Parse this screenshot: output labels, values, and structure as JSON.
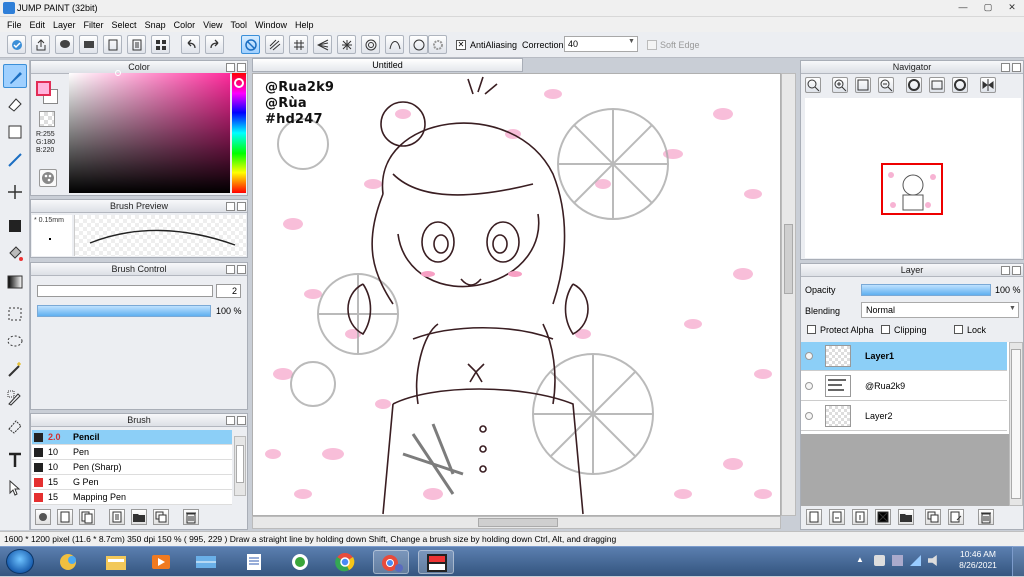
{
  "window": {
    "title": "JUMP PAINT (32bit)",
    "min": "—",
    "max": "▢",
    "close": "✕"
  },
  "menu": [
    "File",
    "Edit",
    "Layer",
    "Filter",
    "Select",
    "Snap",
    "Color",
    "View",
    "Tool",
    "Window",
    "Help"
  ],
  "toolbar": {
    "antialiasing_label": "AntiAliasing",
    "antialiasing_mark": "✕",
    "correction_label": "Correction",
    "correction_value": "40",
    "soft_edge_label": "Soft Edge"
  },
  "color_panel": {
    "title": "Color",
    "r": "R:255",
    "g": "G:180",
    "b": "B:220",
    "fg": "#ffb4dc"
  },
  "brush_preview": {
    "title": "Brush Preview",
    "size_label": "* 0.15mm"
  },
  "brush_control": {
    "title": "Brush Control",
    "size": "2",
    "opacity": "100 %"
  },
  "brush_panel": {
    "title": "Brush",
    "items": [
      {
        "size": "2.0",
        "name": "Pencil",
        "color": "#222222"
      },
      {
        "size": "10",
        "name": "Pen",
        "color": "#222222"
      },
      {
        "size": "10",
        "name": "Pen (Sharp)",
        "color": "#222222"
      },
      {
        "size": "15",
        "name": "G Pen",
        "color": "#e53030"
      },
      {
        "size": "15",
        "name": "Mapping Pen",
        "color": "#e53030"
      }
    ]
  },
  "canvas": {
    "tab": "Untitled",
    "watermark": [
      "@Rua2k9",
      "@Rùa",
      "#hd247"
    ]
  },
  "navigator": {
    "title": "Navigator"
  },
  "layer_panel": {
    "title": "Layer",
    "opacity_label": "Opacity",
    "opacity_value": "100 %",
    "blending_label": "Blending",
    "blending_value": "Normal",
    "protect_alpha": "Protect Alpha",
    "clipping": "Clipping",
    "lock": "Lock",
    "layers": [
      {
        "name": "Layer1",
        "selected": true
      },
      {
        "name": "@Rua2k9",
        "selected": false
      },
      {
        "name": "Layer2",
        "selected": false
      }
    ]
  },
  "status": {
    "text": "1600 * 1200 pixel  (11.6 * 8.7cm)  350 dpi  150 %  ( 995, 229 )  Draw a straight line by holding down Shift, Change a brush size by holding down Ctrl, Alt, and dragging"
  },
  "taskbar": {
    "time": "10:46 AM",
    "date": "8/26/2021"
  },
  "colors": {
    "accent": "#3b8fd8",
    "selection": "#8ccff7",
    "nav_frame": "#ee0000"
  }
}
